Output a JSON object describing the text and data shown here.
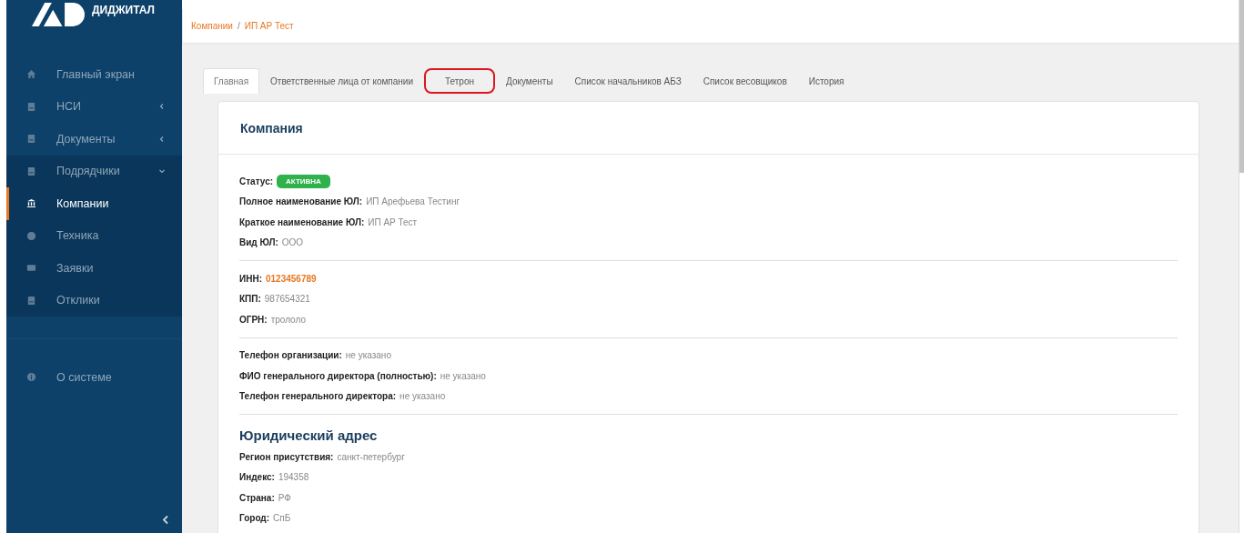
{
  "logo": {
    "text": "ДИДЖИТАЛ"
  },
  "sidebar": {
    "items": [
      {
        "label": "Главный экран",
        "kind": "home",
        "selected": false
      },
      {
        "label": "НСИ",
        "kind": "doc",
        "selected": false,
        "expanded": false
      },
      {
        "label": "Документы",
        "kind": "doc",
        "selected": false,
        "expanded": false
      },
      {
        "label": "Подрядчики",
        "kind": "doc",
        "selected": false,
        "expanded": true,
        "children": [
          {
            "label": "Компании",
            "kind": "bank",
            "selected": true
          },
          {
            "label": "Техника",
            "kind": "circle",
            "selected": false
          },
          {
            "label": "Заявки",
            "kind": "card",
            "selected": false
          },
          {
            "label": "Отклики",
            "kind": "doc",
            "selected": false
          }
        ]
      }
    ],
    "footer_items": [
      {
        "label": "О системе",
        "kind": "info",
        "selected": false
      }
    ]
  },
  "breadcrumb": {
    "separator": "/",
    "items": [
      "Компании",
      "ИП АР Тест"
    ]
  },
  "tabs": [
    {
      "label": "Главная",
      "selected": true,
      "highlighted": false
    },
    {
      "label": "Ответственные лица от компании",
      "selected": false,
      "highlighted": false
    },
    {
      "label": "Тетрон",
      "selected": false,
      "highlighted": true
    },
    {
      "label": "Документы",
      "selected": false,
      "highlighted": false
    },
    {
      "label": "Список начальников АБЗ",
      "selected": false,
      "highlighted": false
    },
    {
      "label": "Список весовщиков",
      "selected": false,
      "highlighted": false
    },
    {
      "label": "История",
      "selected": false,
      "highlighted": false
    }
  ],
  "card": {
    "title": "Компания",
    "sections": [
      {
        "fields": [
          {
            "label": "Статус:",
            "value": "АКТИВНА",
            "kind": "badge"
          },
          {
            "label": "Полное наименование ЮЛ:",
            "value": "ИП Арефьева Тестинг",
            "kind": "text"
          },
          {
            "label": "Краткое наименование ЮЛ:",
            "value": "ИП АР Тест",
            "kind": "text"
          },
          {
            "label": "Вид ЮЛ:",
            "value": "ООО",
            "kind": "text"
          }
        ]
      },
      {
        "fields": [
          {
            "label": "ИНН:",
            "value": "0123456789",
            "kind": "accent"
          },
          {
            "label": "КПП:",
            "value": "987654321",
            "kind": "text"
          },
          {
            "label": "ОГРН:",
            "value": "трололо",
            "kind": "text"
          }
        ]
      },
      {
        "fields": [
          {
            "label": "Телефон организации:",
            "value": "не указано",
            "kind": "text"
          },
          {
            "label": "ФИО генерального директора (полностью):",
            "value": "не указано",
            "kind": "text"
          },
          {
            "label": "Телефон генерального директора:",
            "value": "не указано",
            "kind": "text"
          }
        ]
      },
      {
        "title": "Юридический адрес",
        "fields": [
          {
            "label": "Регион присутствия:",
            "value": "санкт-петербург",
            "kind": "text"
          },
          {
            "label": "Индекс:",
            "value": "194358",
            "kind": "text"
          },
          {
            "label": "Страна:",
            "value": "РФ",
            "kind": "text"
          },
          {
            "label": "Город:",
            "value": "СпБ",
            "kind": "text"
          }
        ]
      }
    ]
  }
}
